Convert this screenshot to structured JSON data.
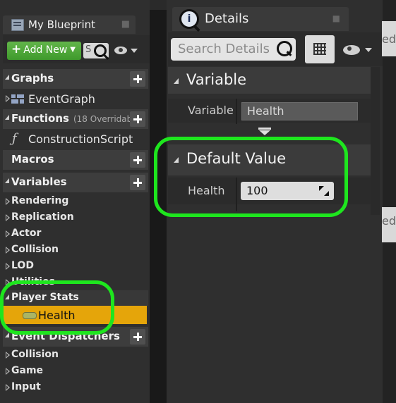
{
  "my_blueprint": {
    "tab_title": "My Blueprint",
    "add_new_label": "Add New",
    "search_placeholder": "S",
    "categories": {
      "graphs": "Graphs",
      "functions": "Functions",
      "functions_override": "(18 Overridab",
      "macros": "Macros",
      "variables": "Variables",
      "event_dispatchers": "Event Dispatchers"
    },
    "graph_items": [
      "EventGraph"
    ],
    "function_items": [
      "ConstructionScript"
    ],
    "variable_groups_top": [
      "Rendering",
      "Replication",
      "Actor",
      "Collision",
      "LOD",
      "Utilities"
    ],
    "player_stats_label": "Player Stats",
    "player_stats_variable": "Health",
    "dispatcher_groups": [
      "Collision",
      "Game",
      "Input"
    ]
  },
  "details": {
    "tab_title": "Details",
    "search_placeholder": "Search Details",
    "variable_section": "Variable",
    "variable_row_label": "Variable",
    "variable_name_value": "Health",
    "default_value_section": "Default Value",
    "default_row_label": "Health",
    "default_value": "100"
  },
  "background_right": {
    "node_text_1": "ed.",
    "node_text_2": "ed."
  },
  "colors": {
    "highlight": "#1ee61e",
    "selected_row": "#e5a50a",
    "add_new_green": "#4faa38"
  },
  "icons": [
    "blueprint-icon",
    "search-icon",
    "eye-icon",
    "plus-icon",
    "graph-icon",
    "function-icon",
    "info-icon",
    "grid-icon",
    "variable-pill-icon",
    "expand-arrow-icon",
    "reset-icon"
  ]
}
